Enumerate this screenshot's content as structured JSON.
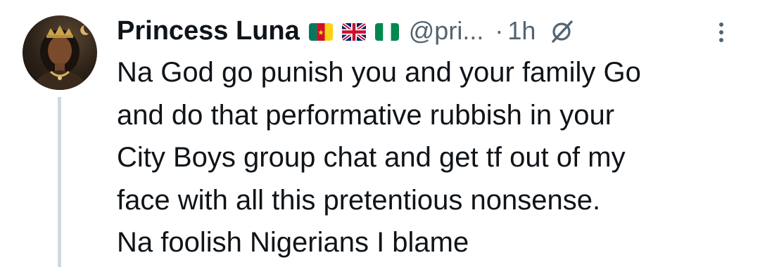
{
  "tweet": {
    "author_name": "Princess Luna",
    "author_flags": [
      "cameroon-flag",
      "uk-flag",
      "nigeria-flag"
    ],
    "handle": "@pri...",
    "separator": "·",
    "timestamp": "1h",
    "text": "Na God go punish you and your family Go\nand do that performative rubbish in your\nCity Boys group chat and get tf out of my\nface with all this pretentious nonsense.\nNa foolish Nigerians I blame",
    "icons": {
      "grok": "grok-icon",
      "more": "more-options-icon"
    }
  },
  "colors": {
    "text_primary": "#0f1419",
    "text_secondary": "#536471",
    "thread_line": "#cfd9de",
    "background": "#ffffff"
  }
}
